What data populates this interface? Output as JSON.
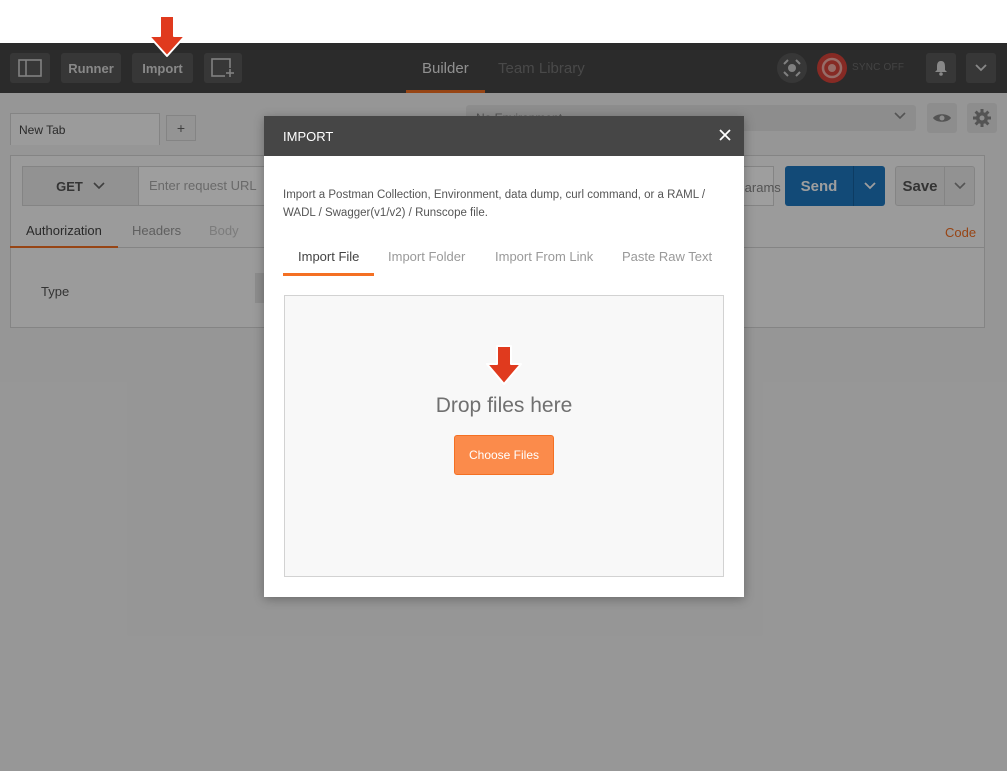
{
  "header": {
    "runner_label": "Runner",
    "import_label": "Import",
    "tabs": [
      {
        "label": "Builder",
        "active": true
      },
      {
        "label": "Team Library",
        "active": false
      }
    ],
    "sync_label": "SYNC OFF",
    "icons": [
      "sidebar-toggle-icon",
      "new-window-icon",
      "interceptor-icon",
      "sync-icon",
      "bell-icon",
      "chevron-down-icon"
    ]
  },
  "workspace": {
    "request_tab_label": "New Tab",
    "add_tab_label": "+",
    "environment_placeholder": "No Environment",
    "method": "GET",
    "url_placeholder": "Enter request URL",
    "params_label": "Params",
    "send_label": "Send",
    "save_label": "Save",
    "sub_tabs": [
      "Authorization",
      "Headers",
      "Body"
    ],
    "code_label": "Code",
    "type_label": "Type"
  },
  "modal": {
    "title": "IMPORT",
    "description": "Import a Postman Collection, Environment, data dump, curl command, or a RAML / WADL / Swagger(v1/v2) / Runscope file.",
    "tabs": [
      {
        "label": "Import File",
        "active": true
      },
      {
        "label": "Import Folder",
        "active": false
      },
      {
        "label": "Import From Link",
        "active": false
      },
      {
        "label": "Paste Raw Text",
        "active": false
      }
    ],
    "drop_text": "Drop files here",
    "choose_label": "Choose Files"
  },
  "colors": {
    "accent": "#f47023",
    "header_bg": "#464646",
    "send_blue": "#1d78c1",
    "choose_orange": "#fb8b4b",
    "callout_red": "#e03a1e"
  }
}
